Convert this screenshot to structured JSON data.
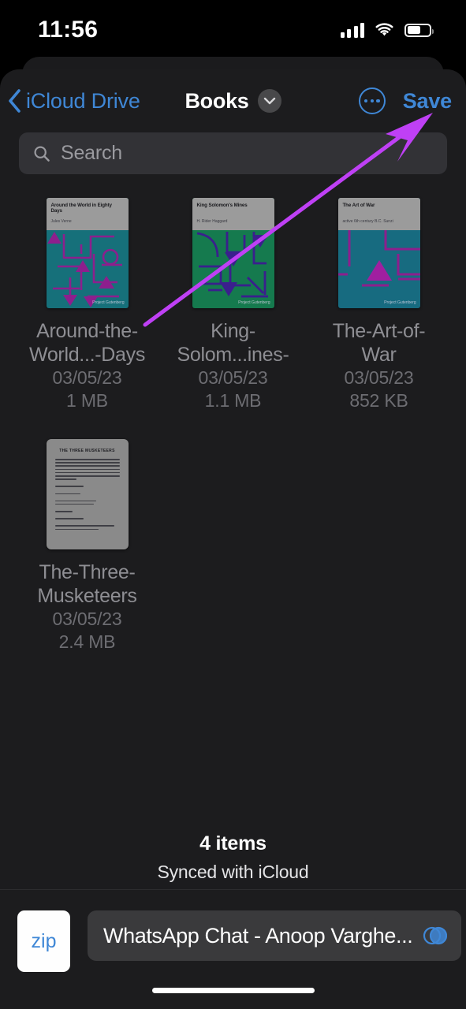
{
  "status_bar": {
    "time": "11:56",
    "signal_icon": "cellular-bars-icon",
    "wifi_icon": "wifi-icon",
    "battery_icon": "battery-icon",
    "battery_level": 62
  },
  "nav": {
    "back_label": "iCloud Drive",
    "back_icon": "chevron-left-icon",
    "title": "Books",
    "title_chevron_icon": "chevron-down-icon",
    "more_icon": "ellipsis-circle-icon",
    "save_label": "Save",
    "accent_color": "#3f87d6"
  },
  "search": {
    "placeholder": "Search",
    "icon": "search-icon"
  },
  "files": [
    {
      "name": "Around-the-World...-Days",
      "date": "03/05/23",
      "size": "1 MB",
      "thumb_type": "book-cover",
      "cover": {
        "title": "Around the World in Eighty Days",
        "author": "Jules Verne",
        "imprint": "Project Gutenberg",
        "bg_color": "#16707a",
        "accent_color": "#8d1f8d",
        "header_color": "#9b9b9b"
      }
    },
    {
      "name": "King-Solom...ines-",
      "date": "03/05/23",
      "size": "1.1 MB",
      "thumb_type": "book-cover",
      "cover": {
        "title": "King Solomon's Mines",
        "author": "H. Rider Haggard",
        "imprint": "Project Gutenberg",
        "bg_color": "#157a4e",
        "accent_color": "#3a1f8d",
        "header_color": "#9b9b9b"
      }
    },
    {
      "name": "The-Art-of-War",
      "date": "03/05/23",
      "size": "852 KB",
      "thumb_type": "book-cover",
      "cover": {
        "title": "The Art of War",
        "author": "active 6th century B.C. Sunzi",
        "imprint": "Project Gutenberg",
        "bg_color": "#176b80",
        "accent_color": "#8d1f8d",
        "header_color": "#9b9b9b"
      }
    },
    {
      "name": "The-Three-Musketeers",
      "date": "03/05/23",
      "size": "2.4 MB",
      "thumb_type": "document-page",
      "document": {
        "title": "THE THREE MUSKETEERS",
        "page_color": "#8a8a8a"
      }
    }
  ],
  "footer": {
    "item_count": "4 items",
    "sync_status": "Synced with iCloud"
  },
  "bottom_bar": {
    "file_type_label": "zip",
    "file_name": "WhatsApp Chat - Anoop Varghe...",
    "overlap_icon": "overlapping-circles-icon"
  },
  "annotation": {
    "arrow_color": "#bf40f5",
    "points_to": "Save"
  }
}
